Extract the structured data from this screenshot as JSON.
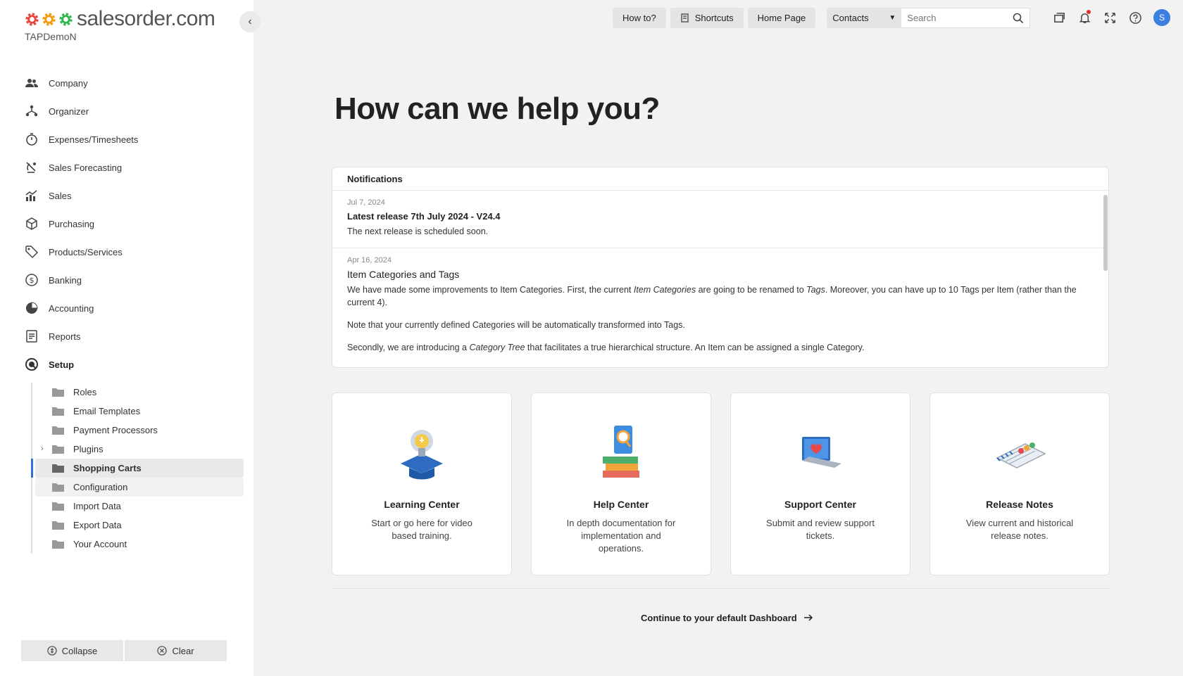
{
  "brand": {
    "name": "salesorder.com",
    "account": "TAPDemoN"
  },
  "sidebar": {
    "items": [
      {
        "label": "Company",
        "icon": "users-icon"
      },
      {
        "label": "Organizer",
        "icon": "organizer-icon"
      },
      {
        "label": "Expenses/Timesheets",
        "icon": "stopwatch-icon"
      },
      {
        "label": "Sales Forecasting",
        "icon": "satellite-icon"
      },
      {
        "label": "Sales",
        "icon": "chart-icon"
      },
      {
        "label": "Purchasing",
        "icon": "box-icon"
      },
      {
        "label": "Products/Services",
        "icon": "tag-icon"
      },
      {
        "label": "Banking",
        "icon": "dollar-icon"
      },
      {
        "label": "Accounting",
        "icon": "pie-icon"
      },
      {
        "label": "Reports",
        "icon": "report-icon"
      },
      {
        "label": "Setup",
        "icon": "setup-icon"
      }
    ],
    "setup_children": [
      {
        "label": "Roles"
      },
      {
        "label": "Email Templates"
      },
      {
        "label": "Payment Processors"
      },
      {
        "label": "Plugins"
      },
      {
        "label": "Shopping Carts"
      },
      {
        "label": "Configuration"
      },
      {
        "label": "Import Data"
      },
      {
        "label": "Export Data"
      },
      {
        "label": "Your Account"
      }
    ],
    "collapse_label": "Collapse",
    "clear_label": "Clear"
  },
  "topbar": {
    "how_to": "How to?",
    "shortcuts": "Shortcuts",
    "home_page": "Home Page",
    "search_scope": "Contacts",
    "search_placeholder": "Search",
    "avatar_initial": "S"
  },
  "main": {
    "heading": "How can we help you?",
    "notifications_title": "Notifications",
    "notifications": [
      {
        "date": "Jul 7, 2024",
        "title": "Latest release 7th July 2024 - V24.4",
        "text": "The next release is scheduled soon."
      },
      {
        "date": "Apr 16, 2024",
        "title": "Item Categories and Tags",
        "p1_a": "We have made some improvements to Item Categories. First, the current ",
        "p1_em1": "Item Categories",
        "p1_b": " are going to be renamed to ",
        "p1_em2": "Tags",
        "p1_c": ". Moreover, you can have up to 10 Tags per Item (rather than the current 4).",
        "p2": "Note that your currently defined Categories will be automatically transformed into Tags.",
        "p3_a": "Secondly, we are introducing a ",
        "p3_em": "Category Tree",
        "p3_b": " that facilitates a true hierarchical structure. An Item can be assigned a single Category."
      }
    ],
    "cards": [
      {
        "title": "Learning Center",
        "desc": "Start or go here for video based training."
      },
      {
        "title": "Help Center",
        "desc": "In depth documentation for implementation and operations."
      },
      {
        "title": "Support Center",
        "desc": "Submit and review support tickets."
      },
      {
        "title": "Release Notes",
        "desc": "View current and historical release notes."
      }
    ],
    "continue_label": "Continue to your default Dashboard"
  },
  "colors": {
    "accent": "#2f6fd6",
    "logo_red": "#e8473b",
    "logo_orange": "#f39c12",
    "logo_green": "#2db84d"
  }
}
